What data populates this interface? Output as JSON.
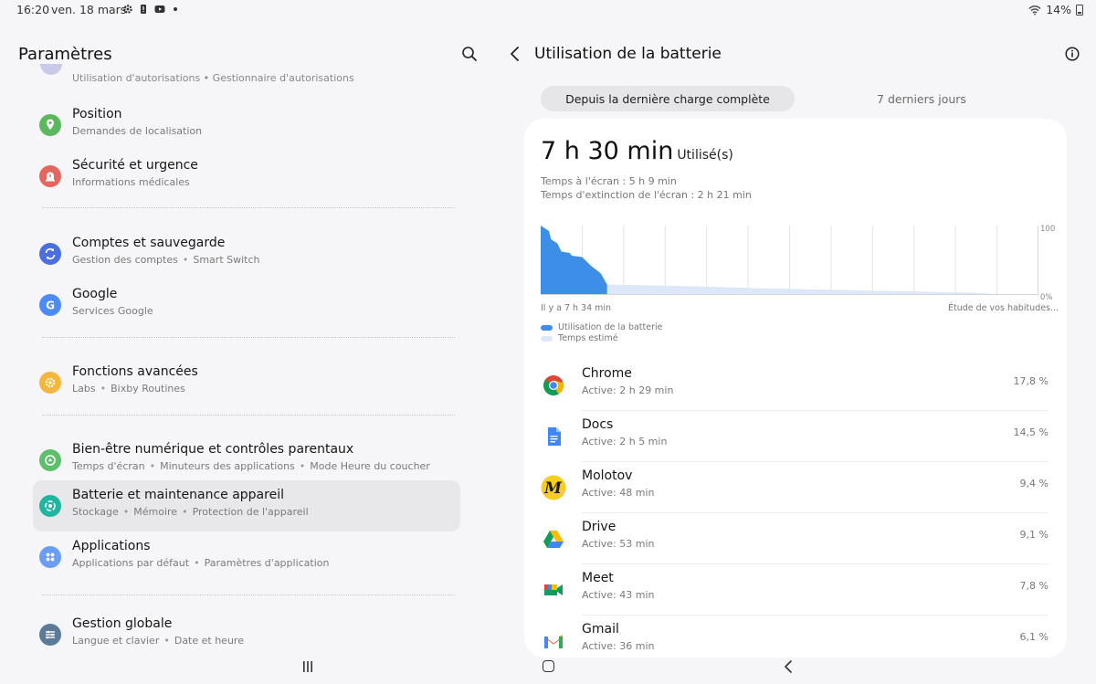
{
  "status_bar": {
    "time": "16:20",
    "date": "ven. 18 mars",
    "battery": "14%"
  },
  "left_panel": {
    "title": "Paramètres",
    "cut_item_subtitle": "Utilisation d'autorisations  •  Gestionnaire d'autorisations",
    "items": [
      {
        "title": "Position",
        "subtitle": [
          "Demandes de localisation"
        ],
        "icon": "location-icon",
        "color": "#5cb85c"
      },
      {
        "title": "Sécurité et urgence",
        "subtitle": [
          "Informations médicales"
        ],
        "icon": "alert-icon",
        "color": "#e5665f"
      },
      {
        "title": "Comptes et sauvegarde",
        "subtitle": [
          "Gestion des comptes",
          "Smart Switch"
        ],
        "icon": "sync-icon",
        "color": "#4a6fe0"
      },
      {
        "title": "Google",
        "subtitle": [
          "Services Google"
        ],
        "icon": "google-icon",
        "color": "#4c8bf5"
      },
      {
        "title": "Fonctions avancées",
        "subtitle": [
          "Labs",
          "Bixby Routines"
        ],
        "icon": "advanced-features-icon",
        "color": "#f4b63b"
      },
      {
        "title": "Bien-être numérique et contrôles parentaux",
        "subtitle": [
          "Temps d'écran",
          "Minuteurs des applications",
          "Mode Heure du coucher"
        ],
        "icon": "wellbeing-icon",
        "color": "#5ebf6a"
      },
      {
        "title": "Batterie et maintenance appareil",
        "subtitle": [
          "Stockage",
          "Mémoire",
          "Protection de l'appareil"
        ],
        "icon": "device-care-icon",
        "color": "#1fb5a0"
      },
      {
        "title": "Applications",
        "subtitle": [
          "Applications par défaut",
          "Paramètres d'application"
        ],
        "icon": "apps-icon",
        "color": "#6a9ef5"
      },
      {
        "title": "Gestion globale",
        "subtitle": [
          "Langue et clavier",
          "Date et heure"
        ],
        "icon": "general-management-icon",
        "color": "#5d7b98"
      }
    ]
  },
  "right_panel": {
    "title": "Utilisation de la batterie",
    "tabs": [
      "Depuis la dernière charge complète",
      "7 derniers jours"
    ],
    "usage_value": "7 h 30 min",
    "usage_unit": "Utilisé(s)",
    "screen_on": "Temps à l'écran : 5 h 9 min",
    "screen_off": "Temps d'extinction de l'écran : 2 h 21 min",
    "chart_label_start": "Il y a 7 h 34 min",
    "chart_label_end": "Étude de vos habitudes...",
    "axis_max_label": "100",
    "axis_min_label": "0%",
    "legend": [
      {
        "label": "Utilisation de la batterie",
        "color": "#3d8ee6"
      },
      {
        "label": "Temps estimé",
        "color": "#dce8f7"
      }
    ],
    "apps": [
      {
        "name": "Chrome",
        "active": "Active: 2 h 29 min",
        "percent": "17,8 %",
        "icon": "chrome-icon"
      },
      {
        "name": "Docs",
        "active": "Active: 2 h 5 min",
        "percent": "14,5 %",
        "icon": "docs-icon"
      },
      {
        "name": "Molotov",
        "active": "Active: 48 min",
        "percent": "9,4 %",
        "icon": "molotov-icon"
      },
      {
        "name": "Drive",
        "active": "Active: 53 min",
        "percent": "9,1 %",
        "icon": "drive-icon"
      },
      {
        "name": "Meet",
        "active": "Active: 43 min",
        "percent": "7,8 %",
        "icon": "meet-icon"
      },
      {
        "name": "Gmail",
        "active": "Active: 36 min",
        "percent": "6,1 %",
        "icon": "gmail-icon"
      }
    ]
  },
  "chart_data": {
    "type": "area",
    "y_range": [
      0,
      100
    ],
    "x_range_hours": [
      0,
      24
    ],
    "grid": "vertical",
    "used_series": {
      "name": "Utilisation de la batterie",
      "x": [
        0,
        0.4,
        0.5,
        0.8,
        1.0,
        1.4,
        1.5,
        2.0,
        2.4,
        2.9,
        3.2
      ],
      "y": [
        100,
        92,
        80,
        74,
        62,
        60,
        56,
        54,
        42,
        30,
        14
      ]
    },
    "estimated_series": {
      "name": "Temps estimé",
      "x": [
        3.2,
        6.4,
        11.2,
        20.8,
        22.0
      ],
      "y": [
        14,
        12,
        8,
        2,
        0
      ]
    }
  }
}
